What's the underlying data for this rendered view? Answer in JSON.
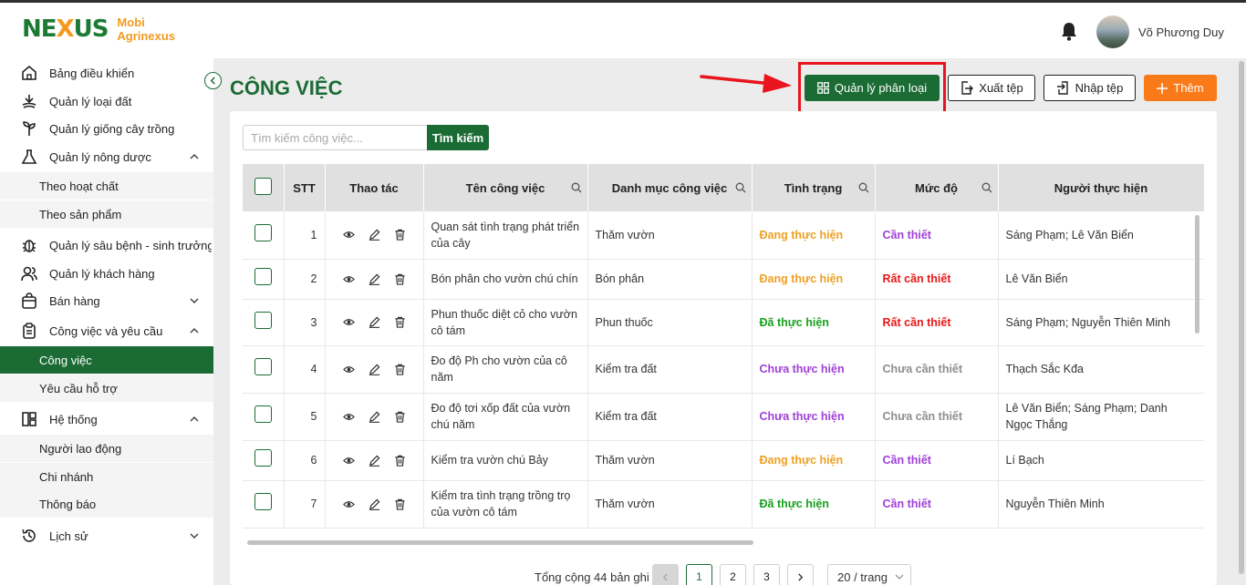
{
  "brand": {
    "logo_left": "NE",
    "logo_x": "X",
    "logo_right": "US",
    "sub1": "Mobi",
    "sub2": "Agrinexus"
  },
  "user": {
    "name": "Võ Phương Duy"
  },
  "sidebar": {
    "items": [
      {
        "label": "Bảng điều khiển",
        "icon": "dashboard-icon"
      },
      {
        "label": "Quản lý loại đất",
        "icon": "soil-icon"
      },
      {
        "label": "Quản lý giống cây trồng",
        "icon": "plant-icon"
      },
      {
        "label": "Quản lý nông dược",
        "icon": "flask-icon"
      },
      {
        "label": "Theo hoạt chất"
      },
      {
        "label": "Theo sản phẩm"
      },
      {
        "label": "Quản lý sâu bệnh - sinh trưởng",
        "icon": "bug-icon"
      },
      {
        "label": "Quản lý khách hàng",
        "icon": "users-icon"
      },
      {
        "label": "Bán hàng",
        "icon": "bag-icon"
      },
      {
        "label": "Công việc và yêu cầu",
        "icon": "clipboard-icon"
      },
      {
        "label": "Công việc"
      },
      {
        "label": "Yêu cầu hỗ trợ"
      },
      {
        "label": "Hệ thống",
        "icon": "system-icon"
      },
      {
        "label": "Người lao động"
      },
      {
        "label": "Chi nhánh"
      },
      {
        "label": "Thông báo"
      },
      {
        "label": "Lịch sử",
        "icon": "history-icon"
      }
    ]
  },
  "page": {
    "title": "CÔNG VIỆC"
  },
  "toolbar": {
    "manage_label": "Quản lý phân loại",
    "export_label": "Xuất tệp",
    "import_label": "Nhập tệp",
    "add_label": "Thêm"
  },
  "search": {
    "placeholder": "Tìm kiếm công việc...",
    "button": "Tìm kiếm"
  },
  "table": {
    "headers": [
      "STT",
      "Thao tác",
      "Tên công việc",
      "Danh mục công việc",
      "Tình trạng",
      "Mức độ",
      "Người thực hiện"
    ],
    "rows": [
      {
        "stt": "1",
        "name": "Quan sát tình trạng phát triển của cây",
        "category": "Thăm vườn",
        "status": "Đang thực hiện",
        "level": "Cần thiết",
        "assignee": "Sáng Phạm; Lê  Văn Biển"
      },
      {
        "stt": "2",
        "name": "Bón phân cho vườn chú chín",
        "category": "Bón phân",
        "status": "Đang thực hiện",
        "level": "Rất cần thiết",
        "assignee": "Lê  Văn Biển"
      },
      {
        "stt": "3",
        "name": "Phun thuốc diệt cỏ cho vườn cô tám",
        "category": "Phun thuốc",
        "status": "Đã thực hiện",
        "level": "Rất cần thiết",
        "assignee": "Sáng Phạm; Nguyễn  Thiên Minh"
      },
      {
        "stt": "4",
        "name": "Đo độ Ph cho vườn của cô năm",
        "category": "Kiểm tra đất",
        "status": "Chưa thực hiện",
        "level": "Chưa cần thiết",
        "assignee": "Thạch Sắc Kđa"
      },
      {
        "stt": "5",
        "name": "Đo độ tơi xốp đất của vườn chú năm",
        "category": "Kiểm tra đất",
        "status": "Chưa thực hiện",
        "level": "Chưa cần thiết",
        "assignee": "Lê  Văn Biển; Sáng Phạm; Danh  Ngọc Thắng"
      },
      {
        "stt": "6",
        "name": "Kiểm tra vườn chú Bảy",
        "category": "Thăm vườn",
        "status": "Đang thực hiện",
        "level": "Cần thiết",
        "assignee": "Lí  Bạch"
      },
      {
        "stt": "7",
        "name": "Kiểm tra tình trạng trồng trọ của vườn cô tám",
        "category": "Thăm vườn",
        "status": "Đã thực hiện",
        "level": "Cần thiết",
        "assignee": "Nguyễn  Thiên Minh"
      }
    ]
  },
  "pagination": {
    "total": "Tổng cộng 44 bản ghi",
    "pages": [
      "1",
      "2",
      "3"
    ],
    "current": "1",
    "per_page": "20 / trang"
  },
  "colors": {
    "primary": "#1b6b35",
    "accent": "#fa7a19",
    "highlight": "#e8141e"
  }
}
